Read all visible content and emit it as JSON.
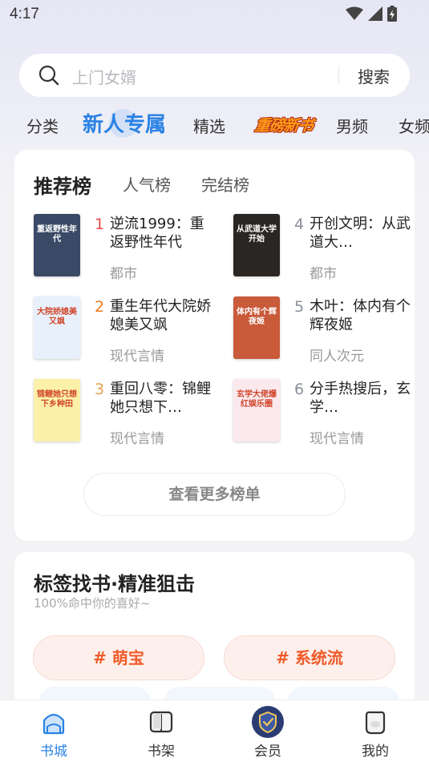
{
  "status_bar": {
    "time": "4:17"
  },
  "search": {
    "placeholder": "上门女婿",
    "button_label": "搜索"
  },
  "tabs": [
    {
      "label": "分类"
    },
    {
      "label": "新人专属",
      "active": true
    },
    {
      "label": "精选"
    },
    {
      "label": "重磅新书"
    },
    {
      "label": "男频"
    },
    {
      "label": "女频"
    }
  ],
  "ranking": {
    "tabs": [
      {
        "label": "推荐榜",
        "active": true
      },
      {
        "label": "人气榜"
      },
      {
        "label": "完结榜"
      }
    ],
    "books": [
      {
        "rank": "1",
        "title": "逆流1999：重返野性年代",
        "genre": "都市",
        "cover_text": "重返野性年代",
        "cover_color": "#3a4a66"
      },
      {
        "rank": "2",
        "title": "重生年代大院娇媳美又飒",
        "genre": "现代言情",
        "cover_text": "大院娇媳美又飒",
        "cover_color": "#e8f1fb"
      },
      {
        "rank": "3",
        "title": "重回八零：锦鲤她只想下…",
        "genre": "现代言情",
        "cover_text": "锦鲤她只想下乡种田",
        "cover_color": "#fbf1a8"
      },
      {
        "rank": "4",
        "title": "开创文明：从武道大…",
        "genre": "都市",
        "cover_text": "从武道大学开始",
        "cover_color": "#2a2624"
      },
      {
        "rank": "5",
        "title": "木叶：体内有个辉夜姬",
        "genre": "同人次元",
        "cover_text": "体内有个辉夜姬",
        "cover_color": "#c95a3a"
      },
      {
        "rank": "6",
        "title": "分手热搜后，玄学…",
        "genre": "现代言情",
        "cover_text": "玄学大佬爆红娱乐圈",
        "cover_color": "#fbe9ee"
      }
    ],
    "rank_colors": [
      "#e84a4a",
      "#f07a20",
      "#e6a050",
      "#8a8f9a",
      "#8a8f9a",
      "#8a8f9a"
    ],
    "more_button": "查看更多榜单"
  },
  "tag_section": {
    "title": "标签找书·精准狙击",
    "subtitle": "100%命中你的喜好~",
    "tags": [
      "# 萌宝",
      "# 系统流"
    ]
  },
  "bottom_nav": [
    {
      "label": "书城",
      "icon": "store-icon",
      "active": true
    },
    {
      "label": "书架",
      "icon": "bookshelf-icon"
    },
    {
      "label": "会员",
      "icon": "vip-shield-icon"
    },
    {
      "label": "我的",
      "icon": "profile-icon"
    }
  ],
  "colors": {
    "accent": "#2a82e4",
    "tag_text": "#f05a2a"
  }
}
